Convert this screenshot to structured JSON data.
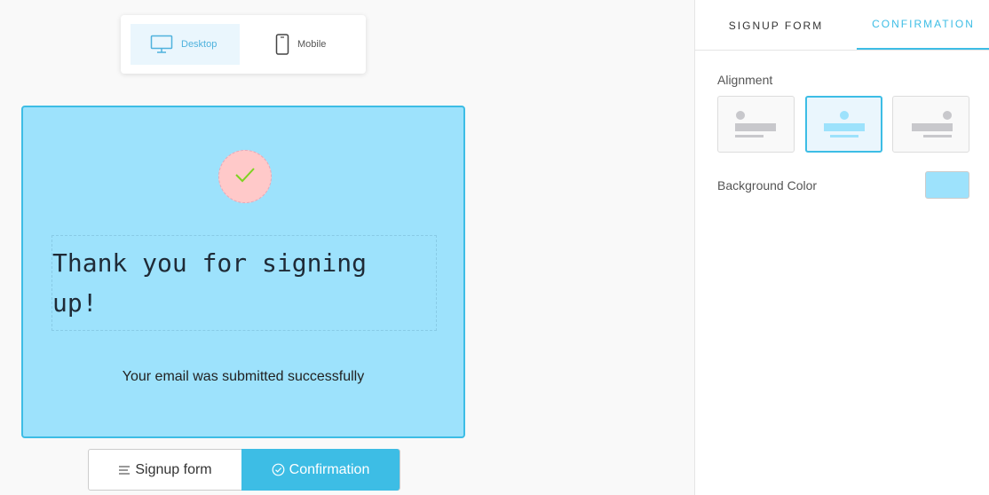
{
  "device_switch": {
    "desktop_label": "Desktop",
    "mobile_label": "Mobile",
    "selected": "Desktop"
  },
  "preview": {
    "icon": "check-icon",
    "title": "Thank you for signing up!",
    "subtitle": "Your email was submitted successfully",
    "background_color": "#9de2fc",
    "icon_background": "#ffc9c9",
    "check_color": "#7ed321"
  },
  "bottom_toggle": {
    "signup_label": "Signup form",
    "confirmation_label": "Confirmation",
    "selected": "Confirmation"
  },
  "panel": {
    "tabs": [
      {
        "label": "SIGNUP FORM"
      },
      {
        "label": "CONFIRMATION"
      }
    ],
    "active_tab": "CONFIRMATION",
    "alignment_label": "Alignment",
    "alignment_selected": "center",
    "background_color_label": "Background Color",
    "background_color_value": "#9de2fc"
  },
  "colors": {
    "accent": "#3dbde5"
  }
}
